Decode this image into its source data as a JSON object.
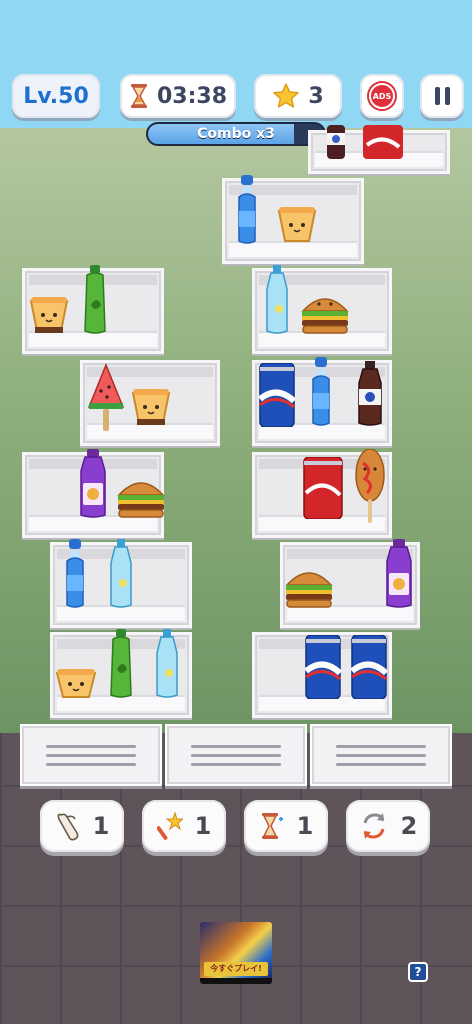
{
  "hud": {
    "level": "Lv.50",
    "timer": "03:38",
    "stars": "3",
    "ads_label": "ADS"
  },
  "combo": {
    "label": "Combo x3",
    "progress": 0.83
  },
  "boosters": [
    {
      "icon": "bone-icon",
      "count": "1"
    },
    {
      "icon": "magic-wand-icon",
      "count": "1"
    },
    {
      "icon": "hourglass-freeze-icon",
      "count": "1"
    },
    {
      "icon": "shuffle-icon",
      "count": "2"
    }
  ],
  "ad": {
    "text": "今すぐプレイ!"
  },
  "help": {
    "label": "?"
  },
  "shelves": [
    {
      "id": "top-partial",
      "items": [
        "cola-bottle",
        "cola-can"
      ]
    },
    {
      "id": "r1",
      "items": [
        "ramune-bottle",
        "pudding"
      ]
    },
    {
      "id": "r2-left",
      "items": [
        "pudding",
        "green-tea-bottle"
      ]
    },
    {
      "id": "r2-right",
      "items": [
        "water-bottle",
        "burger"
      ]
    },
    {
      "id": "r3-left",
      "items": [
        "watermelon-popsicle",
        "pudding"
      ]
    },
    {
      "id": "r3-right",
      "items": [
        "pepsi-can",
        "ramune-bottle",
        "cola-bottle"
      ]
    },
    {
      "id": "r4-left",
      "items": [
        "grape-juice-bottle",
        "burger"
      ]
    },
    {
      "id": "r4-right",
      "items": [
        "cola-can",
        "corn-dog"
      ]
    },
    {
      "id": "r5-left",
      "items": [
        "ramune-bottle",
        "water-bottle"
      ]
    },
    {
      "id": "r5-right",
      "items": [
        "burger",
        "grape-juice-bottle"
      ]
    },
    {
      "id": "r6-left",
      "items": [
        "pudding",
        "green-tea-bottle",
        "water-bottle"
      ]
    },
    {
      "id": "r6-right",
      "items": [
        "pepsi-can",
        "pepsi-can"
      ]
    }
  ],
  "colors": {
    "sky": "#8fd7f3",
    "wall": "#8faf7d",
    "floor": "#5f5459",
    "accent": "#1f6fd0"
  }
}
